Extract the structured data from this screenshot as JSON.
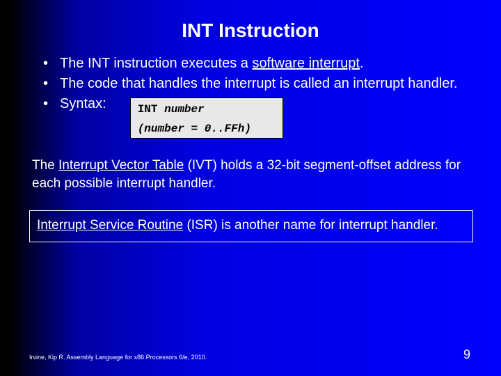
{
  "title": "INT Instruction",
  "bullets": {
    "b1_pre": "The INT instruction executes a ",
    "b1_underlined": "software interrupt",
    "b1_post": ".",
    "b2": "The code that handles the interrupt is called an interrupt handler.",
    "b3_label": "Syntax:"
  },
  "code": {
    "line1_plain": "INT ",
    "line1_italic": "number",
    "line2": "(number = 0..FFh)"
  },
  "para": {
    "pre": "The ",
    "underlined": "Interrupt Vector Table",
    "post": " (IVT) holds a 32-bit segment-offset address for each possible interrupt handler."
  },
  "isr": {
    "underlined": "Interrupt Service Routine",
    "post": " (ISR) is another name for interrupt handler."
  },
  "footer": "Irvine, Kip R. Assembly Language for x86 Processors 6/e, 2010.",
  "page": "9"
}
